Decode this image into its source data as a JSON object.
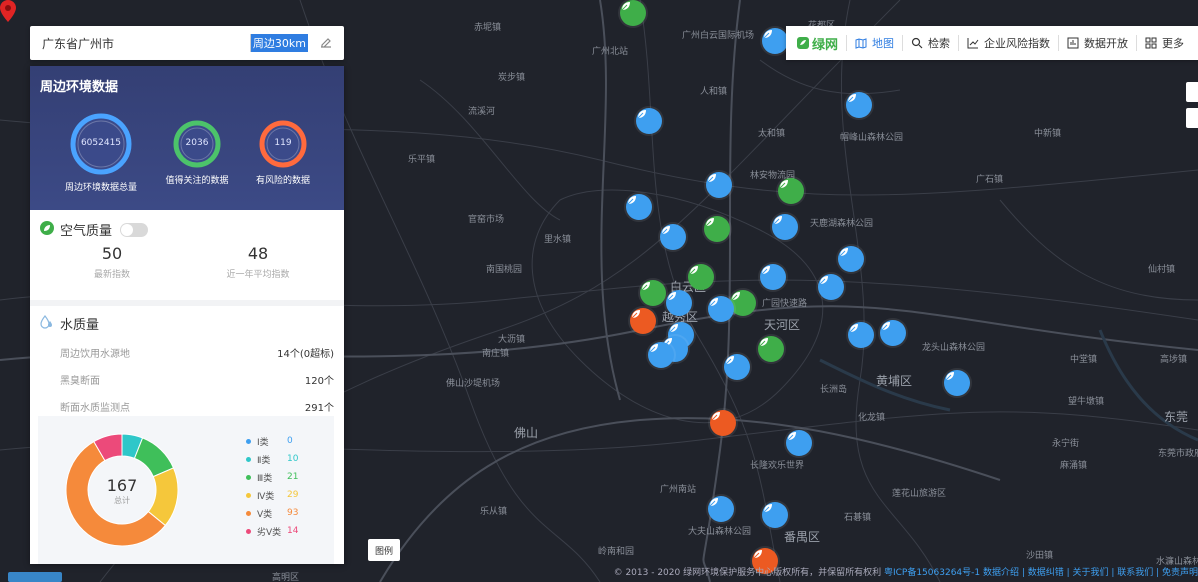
{
  "search": {
    "value": "广东省广州市",
    "radius_label": "周边30km"
  },
  "env": {
    "title": "周边环境数据",
    "stats": [
      {
        "value": "6052415",
        "label": "周边环境数据总量",
        "color": "#4aa3ff"
      },
      {
        "value": "2036",
        "label": "值得关注的数据",
        "color": "#4cc36a"
      },
      {
        "value": "119",
        "label": "有风险的数据",
        "color": "#ff6a3d"
      }
    ]
  },
  "air": {
    "title": "空气质量",
    "latest_value": "50",
    "latest_label": "最新指数",
    "avg_value": "48",
    "avg_label": "近一年平均指数"
  },
  "water": {
    "title": "水质量",
    "items": [
      {
        "label": "周边饮用水源地",
        "value": "14个(0超标)"
      },
      {
        "label": "黑臭断面",
        "value": "120个"
      },
      {
        "label": "断面水质监测点",
        "value": "291个"
      }
    ],
    "total": "167",
    "total_label": "总计",
    "classes": [
      {
        "name": "Ⅰ类",
        "value": 0,
        "color": "#3e9ff0"
      },
      {
        "name": "Ⅱ类",
        "value": 10,
        "color": "#2fc7c9"
      },
      {
        "name": "Ⅲ类",
        "value": 21,
        "color": "#3fbf5a"
      },
      {
        "name": "Ⅳ类",
        "value": 29,
        "color": "#f5c73b"
      },
      {
        "name": "Ⅴ类",
        "value": 93,
        "color": "#f58a3b"
      },
      {
        "name": "劣Ⅴ类",
        "value": 14,
        "color": "#ec4a7a"
      }
    ]
  },
  "toolbar": {
    "logo": "绿网",
    "items": [
      {
        "label": "地图",
        "icon": "map-icon",
        "active": true
      },
      {
        "label": "检索",
        "icon": "search-icon",
        "active": false
      },
      {
        "label": "企业风险指数",
        "icon": "chart-line-icon",
        "active": false
      },
      {
        "label": "数据开放",
        "icon": "bar-chart-icon",
        "active": false
      },
      {
        "label": "更多",
        "icon": "grid-icon",
        "active": false
      }
    ]
  },
  "legend_button": "图例",
  "footer": {
    "copyright": "© 2013 - 2020 绿网环境保护服务中心版权所有，并保留所有权利",
    "links": "粤ICP备15063264号-1 数据介绍 | 数据纠错 | 关于我们 | 联系我们 | 免责声明"
  },
  "map": {
    "places": [
      "广州北站",
      "广州白云国际机场",
      "花都区",
      "赤坭镇",
      "炭步镇",
      "流溪河",
      "人和镇",
      "太和镇",
      "帽峰山森林公园",
      "中新镇",
      "乐平镇",
      "官窑市场",
      "里水镇",
      "林安物流园",
      "天鹿湖森林公园",
      "广石镇",
      "南国桃园",
      "大沥镇",
      "白云区",
      "越秀区",
      "天河区",
      "广园快速路",
      "南庄镇",
      "佛山沙堤机场",
      "长洲岛",
      "黄埔区",
      "龙头山森林公园",
      "佛山",
      "长隆欢乐世界",
      "广州南站",
      "番禺区",
      "大夫山森林公园",
      "东莞",
      "永宁街",
      "中堂镇",
      "高埗镇",
      "麻涌镇",
      "望牛墩镇",
      "化龙镇",
      "莲花山旅游区",
      "石碁镇",
      "乐从镇",
      "高明区",
      "岭南和园",
      "东莞市政府",
      "仙村镇",
      "沙田镇",
      "水濂山森林公园"
    ]
  }
}
